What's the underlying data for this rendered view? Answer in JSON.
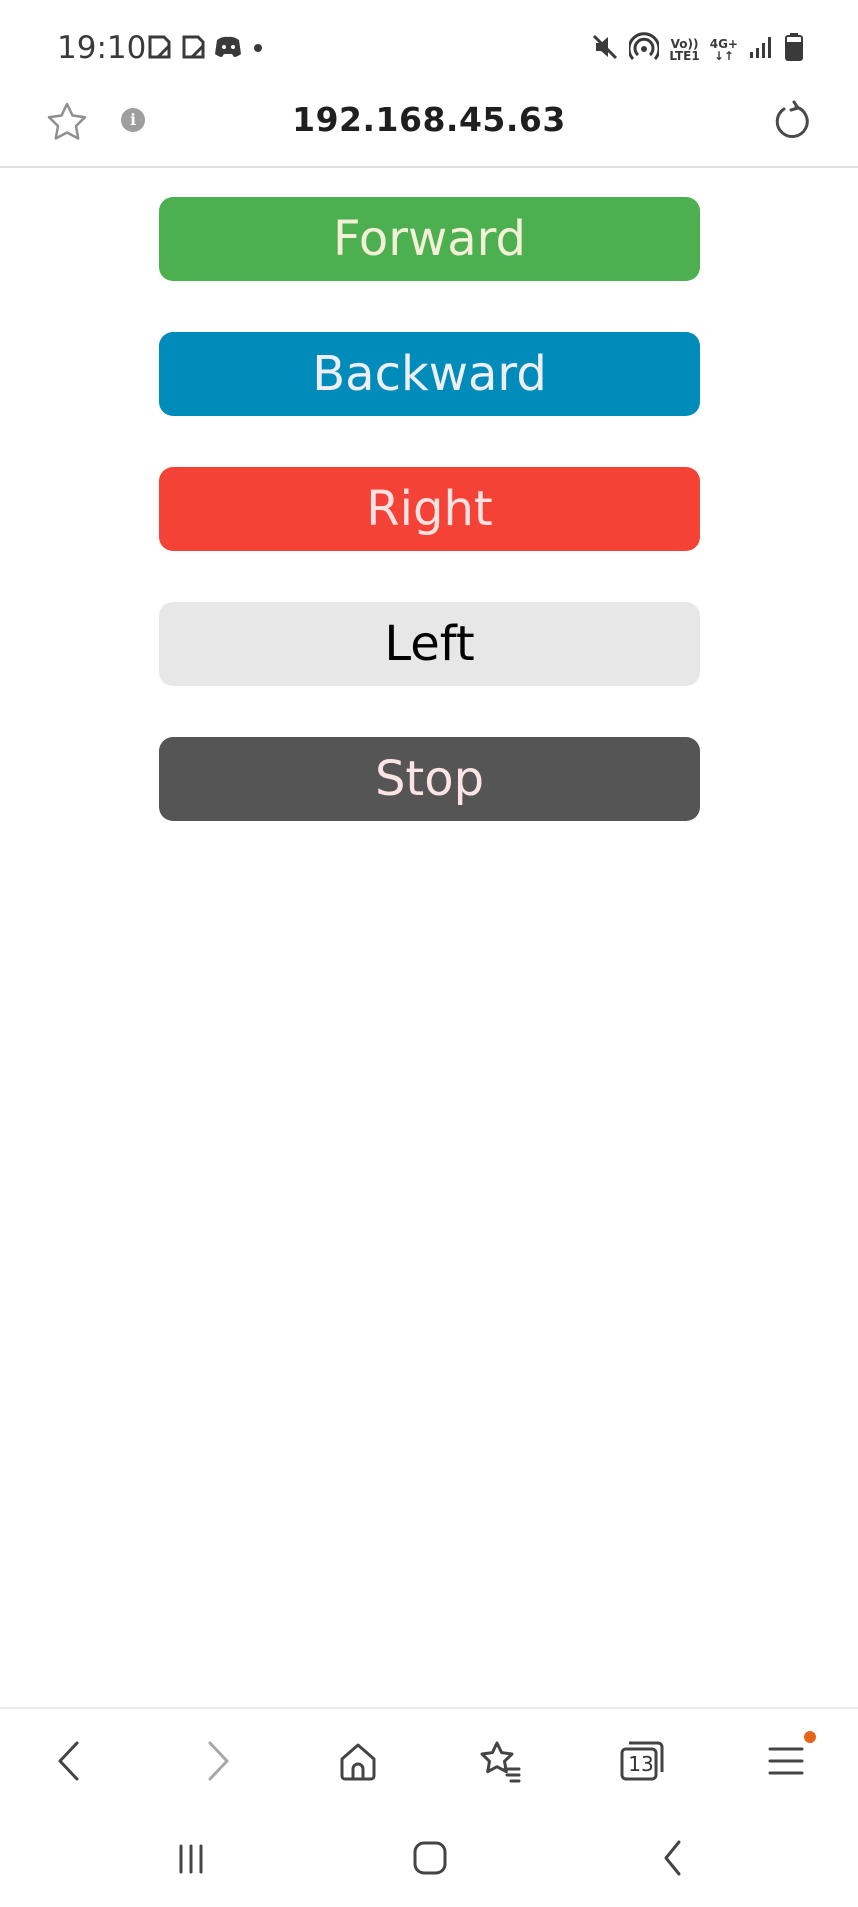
{
  "status_bar": {
    "time": "19:10",
    "volte_top": "Vo))",
    "volte_bottom": "LTE1",
    "network_top": "4G+",
    "network_bottom": "↓↑"
  },
  "url_bar": {
    "url": "192.168.45.63"
  },
  "controls": {
    "forward": "Forward",
    "backward": "Backward",
    "right": "Right",
    "left": "Left",
    "stop": "Stop"
  },
  "colors": {
    "forward": "#4caf50",
    "backward": "#008cba",
    "right": "#f44336",
    "left": "#e7e7e7",
    "stop": "#555555",
    "menu_badge": "#e8641b"
  },
  "toolbar": {
    "tabs_count": "13",
    "icons": [
      "back-icon",
      "forward-icon",
      "home-icon",
      "bookmarks-icon",
      "tabs-icon",
      "menu-icon"
    ]
  },
  "system_nav": {
    "icons": [
      "recents-icon",
      "home-icon",
      "back-icon"
    ]
  }
}
